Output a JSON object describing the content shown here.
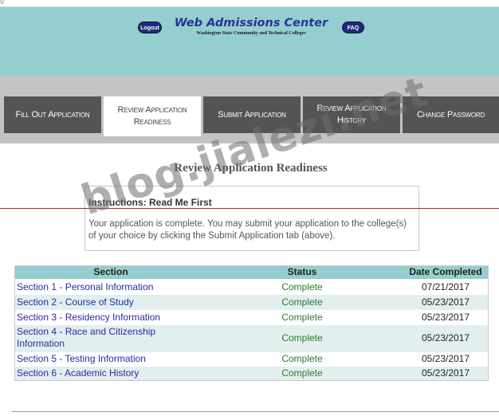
{
  "topstrip": {
    "text": "g"
  },
  "header": {
    "logout_label": "Logout",
    "faq_label": "FAQ",
    "title": "Web Admissions Center",
    "subtitle": "Washington State Community and Technical Colleges"
  },
  "tabs": [
    {
      "label": "Fill Out Application",
      "active": false
    },
    {
      "label": "Review Application Readiness",
      "active": true
    },
    {
      "label": "Submit Application",
      "active": false
    },
    {
      "label": "Review Application History",
      "active": false
    },
    {
      "label": "Change Password",
      "active": false
    }
  ],
  "main": {
    "page_title": "Review Application Readiness",
    "instructions": {
      "heading": "Instructions: Read Me First",
      "body": "Your application is complete. You may submit your application to the college(s) of your choice by clicking the Submit Application tab (above)."
    },
    "table": {
      "headers": [
        "Section",
        "Status",
        "Date Completed"
      ],
      "rows": [
        {
          "section": "Section 1 - Personal Information",
          "status": "Complete",
          "date": "07/21/2017"
        },
        {
          "section": "Section 2 - Course of Study",
          "status": "Complete",
          "date": "05/23/2017"
        },
        {
          "section": "Section 3 - Residency Information",
          "status": "Complete",
          "date": "05/23/2017"
        },
        {
          "section": "Section 4 - Race and Citizenship Information",
          "status": "Complete",
          "date": "05/23/2017"
        },
        {
          "section": "Section 5 - Testing Information",
          "status": "Complete",
          "date": "05/23/2017"
        },
        {
          "section": "Section 6 - Academic History",
          "status": "Complete",
          "date": "05/23/2017"
        }
      ]
    }
  },
  "watermark": "blog.jialezi.net",
  "colors": {
    "header_bg": "#95cece",
    "nav_bg": "#c3c3c3",
    "tab_bg": "#545454",
    "link": "#2a2aa0",
    "status_complete": "#2b7a2b"
  }
}
